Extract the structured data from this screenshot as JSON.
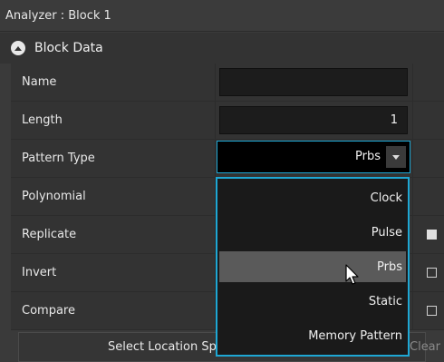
{
  "window": {
    "title": "Analyzer : Block  1"
  },
  "section": {
    "label": "Block Data"
  },
  "rows": [
    {
      "label": "Name",
      "value": ""
    },
    {
      "label": "Length",
      "value": "1"
    },
    {
      "label": "Pattern Type",
      "value": "Prbs"
    },
    {
      "label": "Polynomial"
    },
    {
      "label": "Replicate",
      "checked": true
    },
    {
      "label": "Invert",
      "checked": false
    },
    {
      "label": "Compare",
      "checked": false
    }
  ],
  "dropdown": {
    "options": [
      "Clock",
      "Pulse",
      "Prbs",
      "Static",
      "Memory Pattern"
    ],
    "hovered": "Prbs"
  },
  "buttons": {
    "select_location": "Select Location Sp",
    "clear": "Clear"
  },
  "colors": {
    "accent": "#1ea7d4",
    "background": "#3a3a3a",
    "hover": "#5a5a5a"
  },
  "icons": {
    "collapse": "collapse-up-icon",
    "dropdown": "chevron-down-icon",
    "cursor": "mouse-pointer-icon"
  }
}
